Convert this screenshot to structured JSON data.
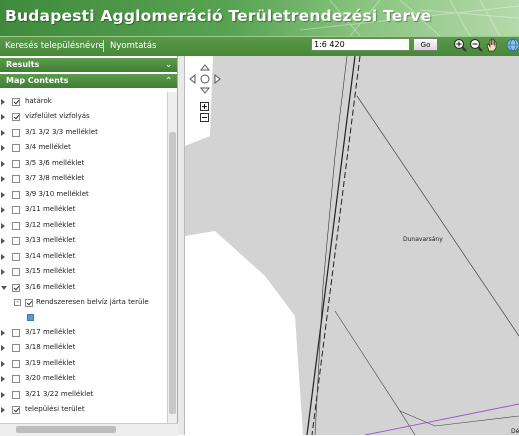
{
  "header": {
    "title": "Budapesti Agglomeráció Területrendezési Terve"
  },
  "toolbar": {
    "search_link": "Keresés településnévre",
    "print_link": "Nyomtatás",
    "scale_value": "1:6 420",
    "go_label": "Go",
    "tools": [
      "zoom-in-icon",
      "zoom-out-icon",
      "pan-hand-icon",
      "globe-icon"
    ]
  },
  "panels": {
    "results_title": "Results",
    "map_contents_title": "Map Contents"
  },
  "layers": [
    {
      "label": "határok",
      "checked": true,
      "expandable": true
    },
    {
      "label": "vízfelület vízfolyás",
      "checked": true,
      "expandable": true
    },
    {
      "label": "3/1 3/2 3/3 melléklet",
      "checked": false,
      "expandable": true
    },
    {
      "label": "3/4 melléklet",
      "checked": false,
      "expandable": true
    },
    {
      "label": "3/5 3/6 melléklet",
      "checked": false,
      "expandable": true
    },
    {
      "label": "3/7 3/8 melléklet",
      "checked": false,
      "expandable": true
    },
    {
      "label": "3/9 3/10 melléklet",
      "checked": false,
      "expandable": true
    },
    {
      "label": "3/11 melléklet",
      "checked": false,
      "expandable": true
    },
    {
      "label": "3/12 melléklet",
      "checked": false,
      "expandable": true
    },
    {
      "label": "3/13 melléklet",
      "checked": false,
      "expandable": true
    },
    {
      "label": "3/14 melléklet",
      "checked": false,
      "expandable": true
    },
    {
      "label": "3/15 melléklet",
      "checked": false,
      "expandable": true
    },
    {
      "label": "3/16 melléklet",
      "checked": true,
      "expandable": true,
      "expanded": true
    },
    {
      "label": "3/17 melléklet",
      "checked": false,
      "expandable": true
    },
    {
      "label": "3/18 melléklet",
      "checked": false,
      "expandable": true
    },
    {
      "label": "3/19 melléklet",
      "checked": false,
      "expandable": true
    },
    {
      "label": "3/20 melléklet",
      "checked": false,
      "expandable": true
    },
    {
      "label": "3/21 3/22 melléklet",
      "checked": false,
      "expandable": true
    },
    {
      "label": "települési terület",
      "checked": true,
      "expandable": true
    }
  ],
  "sublayer": {
    "label": "Rendszeresen belvíz járta terüle",
    "checked": true,
    "legend_color": "#5b9bd5"
  },
  "map": {
    "labels": [
      "Dunavarsány",
      "Dé"
    ],
    "colors": {
      "land": "#d3d3d3",
      "white_area": "#ffffff",
      "boundary": "#a050c8"
    }
  }
}
